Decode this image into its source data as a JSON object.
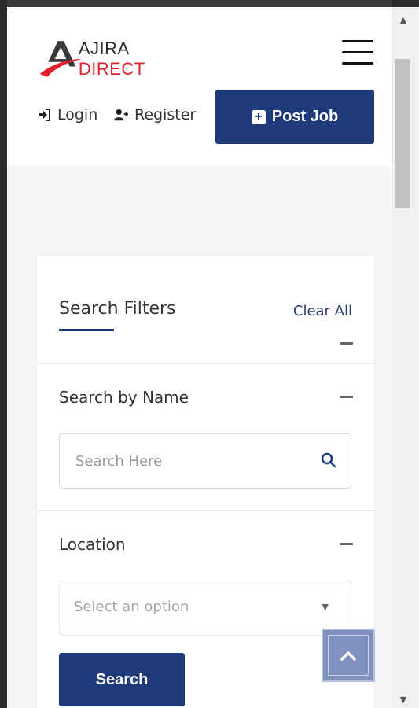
{
  "brand": {
    "logo_part1": "AJIRA",
    "logo_part2": "DIRECT",
    "primary_color": "#1e3a7b",
    "accent_color": "#e11f2b"
  },
  "header": {
    "menu_icon": "hamburger-menu-icon",
    "login_label": "Login",
    "register_label": "Register",
    "post_job_label": "Post Job"
  },
  "filters": {
    "title": "Search Filters",
    "clear_all_label": "Clear All",
    "search_by_name": {
      "label": "Search by Name",
      "placeholder": "Search Here",
      "value": ""
    },
    "location": {
      "label": "Location",
      "selected": "Select an option"
    },
    "search_button_label": "Search"
  },
  "back_to_top_icon": "chevron-up-icon"
}
